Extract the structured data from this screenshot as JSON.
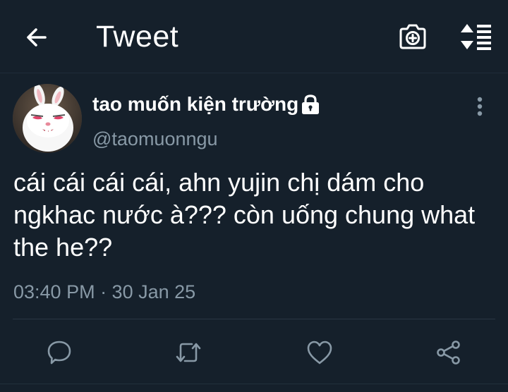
{
  "header": {
    "title": "Tweet",
    "back_icon": "arrow-left-icon",
    "camera_icon": "camera-plus-icon",
    "sort_icon": "sort-list-icon"
  },
  "tweet": {
    "author_name": "tao muốn kiện trường",
    "author_handle": "@taomuonngu",
    "protected": true,
    "text_lines": [
      "cái cái cái cái, ahn yujin chị dám cho",
      "ngkhac nước à??? còn uống chung what",
      "the he??"
    ],
    "timestamp": "03:40 PM · 30 Jan 25"
  },
  "actions": [
    {
      "name": "reply",
      "icon": "reply-icon"
    },
    {
      "name": "retweet",
      "icon": "retweet-icon"
    },
    {
      "name": "like",
      "icon": "heart-icon"
    },
    {
      "name": "share",
      "icon": "share-icon"
    }
  ],
  "colors": {
    "background": "#15202b",
    "text_primary": "#ffffff",
    "text_secondary": "#8899a6"
  }
}
